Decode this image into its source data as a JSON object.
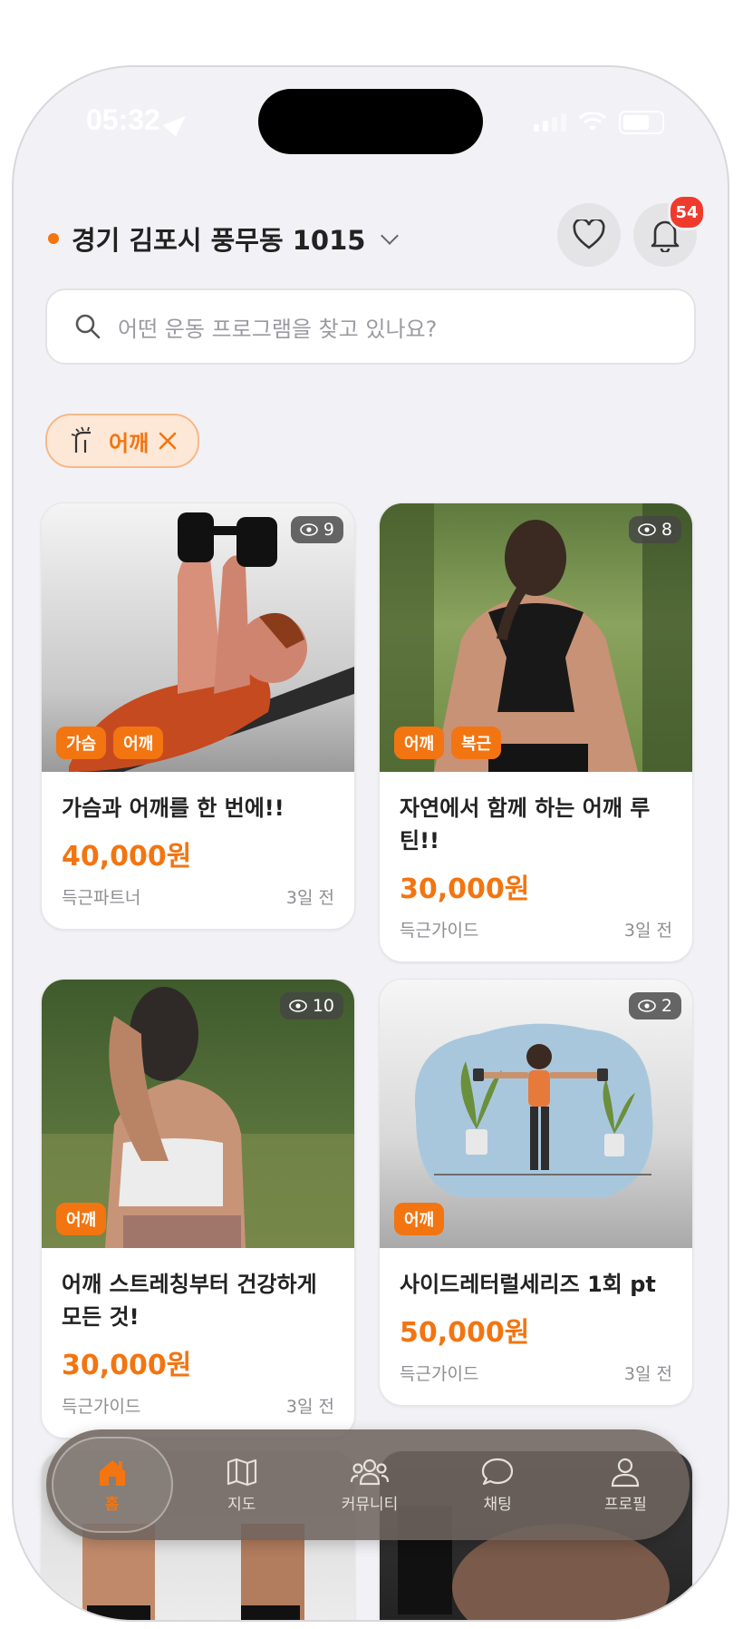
{
  "status_bar": {
    "time": "05:32"
  },
  "header": {
    "location": "경기 김포시 풍무동 1015",
    "notification_count": "54"
  },
  "search": {
    "placeholder": "어떤 운동 프로그램을 찾고 있나요?"
  },
  "filter_chip": {
    "label": "어깨"
  },
  "cards": [
    {
      "title": "가슴과 어깨를 한 번에!!",
      "price": "40,000원",
      "author": "득근파트너",
      "time": "3일 전",
      "views": "9",
      "tags": [
        "가슴",
        "어깨"
      ]
    },
    {
      "title": "자연에서 함께 하는 어깨 루틴!!",
      "price": "30,000원",
      "author": "득근가이드",
      "time": "3일 전",
      "views": "8",
      "tags": [
        "어깨",
        "복근"
      ]
    },
    {
      "title": "어깨 스트레칭부터 건강하게 모든 것!",
      "price": "30,000원",
      "author": "득근가이드",
      "time": "3일 전",
      "views": "10",
      "tags": [
        "어깨"
      ]
    },
    {
      "title": "사이드레터럴세리즈 1회 pt",
      "price": "50,000원",
      "author": "득근가이드",
      "time": "3일 전",
      "views": "2",
      "tags": [
        "어깨"
      ]
    }
  ],
  "bottom_nav": [
    {
      "label": "홈",
      "icon": "home-icon"
    },
    {
      "label": "지도",
      "icon": "map-icon"
    },
    {
      "label": "커뮤니티",
      "icon": "community-icon"
    },
    {
      "label": "채팅",
      "icon": "chat-icon"
    },
    {
      "label": "프로필",
      "icon": "profile-icon"
    }
  ],
  "colors": {
    "accent": "#f27511",
    "badge": "#ef3b2d",
    "background": "#f2f2f6"
  }
}
